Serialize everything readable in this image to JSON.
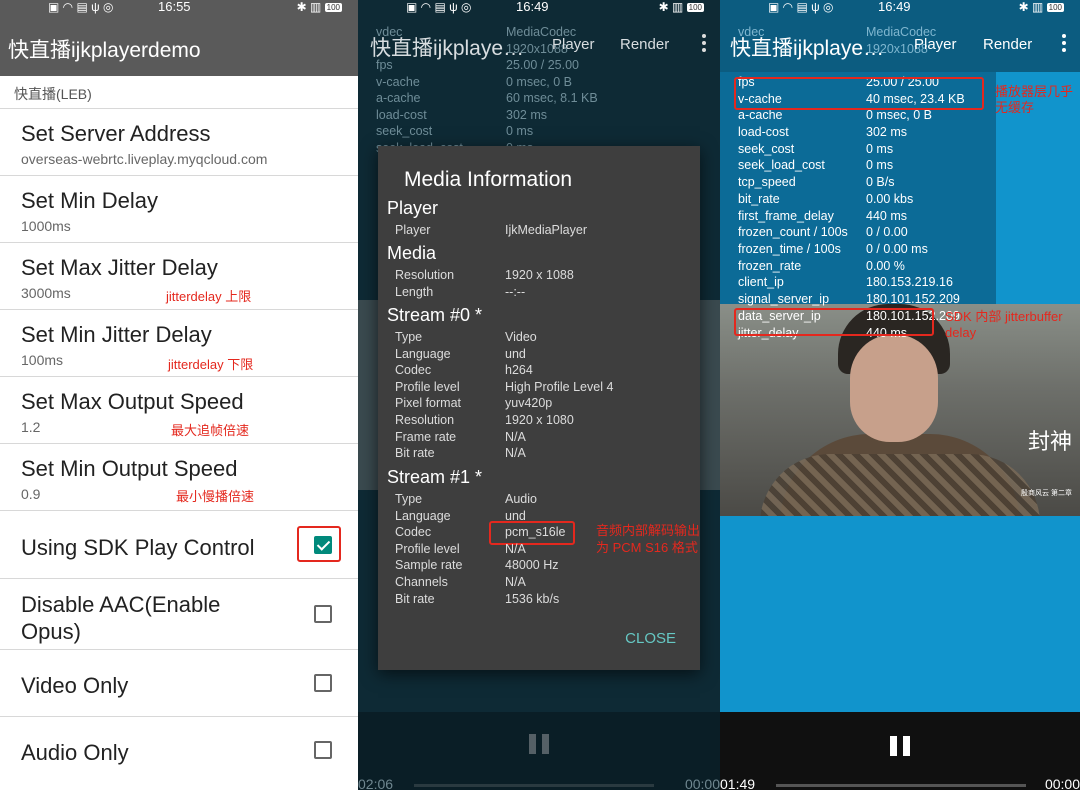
{
  "status_time_1": "16:55",
  "status_time_2": "16:49",
  "status_time_3": "16:49",
  "battery": "100",
  "panel1": {
    "app_title": "快直播ijkplayerdemo",
    "section_header": "快直播(LEB)",
    "items": [
      {
        "title": "Set Server Address",
        "subtitle": "overseas-webrtc.liveplay.myqcloud.com"
      },
      {
        "title": "Set Min Delay",
        "subtitle": "1000ms"
      },
      {
        "title": "Set Max Jitter Delay",
        "subtitle": "3000ms",
        "note": "jitterdelay 上限"
      },
      {
        "title": "Set Min Jitter Delay",
        "subtitle": "100ms",
        "note": "jitterdelay 下限"
      },
      {
        "title": "Set Max Output Speed",
        "subtitle": "1.2",
        "note": "最大追帧倍速"
      },
      {
        "title": "Set Min Output Speed",
        "subtitle": "0.9",
        "note": "最小慢播倍速"
      }
    ],
    "checkboxes": [
      {
        "label": "Using SDK Play Control",
        "checked": true
      },
      {
        "label": "Disable AAC(Enable Opus)",
        "checked": false
      },
      {
        "label": "Video Only",
        "checked": false
      },
      {
        "label": "Audio Only",
        "checked": false
      }
    ]
  },
  "panel2": {
    "overlay_title": "快直播ijkplaye…",
    "menu_player": "Player",
    "menu_render": "Render",
    "bg_stats": [
      {
        "k": "vdec",
        "v": "MediaCodec"
      },
      {
        "k": "",
        "v": "1920x1088"
      },
      {
        "k": "fps",
        "v": "25.00 / 25.00"
      },
      {
        "k": "v-cache",
        "v": "0 msec, 0 B"
      },
      {
        "k": "a-cache",
        "v": "60 msec, 8.1 KB"
      },
      {
        "k": "load-cost",
        "v": "302 ms"
      },
      {
        "k": "seek_cost",
        "v": "0 ms"
      },
      {
        "k": "seek_load_cost",
        "v": "0 ms"
      }
    ],
    "dialog": {
      "title": "Media Information",
      "sections": [
        {
          "name": "Player",
          "rows": [
            {
              "k": "Player",
              "v": "IjkMediaPlayer"
            }
          ]
        },
        {
          "name": "Media",
          "rows": [
            {
              "k": "Resolution",
              "v": "1920 x 1088"
            },
            {
              "k": "Length",
              "v": "--:--"
            }
          ]
        },
        {
          "name": "Stream #0 *",
          "rows": [
            {
              "k": "Type",
              "v": "Video"
            },
            {
              "k": "Language",
              "v": "und"
            },
            {
              "k": "Codec",
              "v": "h264"
            },
            {
              "k": "Profile level",
              "v": "High Profile Level 4"
            },
            {
              "k": "Pixel format",
              "v": "yuv420p"
            },
            {
              "k": "Resolution",
              "v": "1920 x 1080"
            },
            {
              "k": "Frame rate",
              "v": "N/A"
            },
            {
              "k": "Bit rate",
              "v": "N/A"
            }
          ]
        },
        {
          "name": "Stream #1 *",
          "rows": [
            {
              "k": "Type",
              "v": "Audio"
            },
            {
              "k": "Language",
              "v": "und"
            },
            {
              "k": "Codec",
              "v": "pcm_s16le"
            },
            {
              "k": "Profile level",
              "v": "N/A"
            },
            {
              "k": "Sample rate",
              "v": "48000 Hz"
            },
            {
              "k": "Channels",
              "v": "N/A"
            },
            {
              "k": "Bit rate",
              "v": "1536 kb/s"
            }
          ]
        }
      ],
      "close_label": "CLOSE",
      "codec_note": "音频内部解码输出为 PCM S16 格式"
    },
    "time_left": "02:06",
    "time_right": "00:00"
  },
  "panel3": {
    "overlay_title": "快直播ijkplaye…",
    "menu_player": "Player",
    "menu_render": "Render",
    "top_stats": [
      {
        "k": "vdec",
        "v": "MediaCodec"
      },
      {
        "k": "",
        "v": "1920x1088"
      }
    ],
    "stats": [
      {
        "k": "fps",
        "v": "25.00 / 25.00"
      },
      {
        "k": "v-cache",
        "v": "40 msec, 23.4 KB"
      },
      {
        "k": "a-cache",
        "v": "0 msec, 0 B"
      },
      {
        "k": "load-cost",
        "v": "302 ms"
      },
      {
        "k": "seek_cost",
        "v": "0 ms"
      },
      {
        "k": "seek_load_cost",
        "v": "0 ms"
      },
      {
        "k": "tcp_speed",
        "v": "0 B/s"
      },
      {
        "k": "bit_rate",
        "v": "0.00 kbs"
      },
      {
        "k": "first_frame_delay",
        "v": "440 ms"
      },
      {
        "k": "frozen_count / 100s",
        "v": "0 / 0.00"
      },
      {
        "k": "frozen_time / 100s",
        "v": "0 / 0.00 ms"
      },
      {
        "k": "frozen_rate",
        "v": "0.00 %"
      },
      {
        "k": "client_ip",
        "v": "180.153.219.16"
      },
      {
        "k": "signal_server_ip",
        "v": "180.101.152.209"
      },
      {
        "k": "data_server_ip",
        "v": "180.101.152.209"
      },
      {
        "k": "jitter_delay",
        "v": "440 ms"
      }
    ],
    "cache_note": "播放器层几乎无缓存",
    "jitter_note": "SDK 内部 jitterbuffer delay",
    "video_logo": "封神",
    "video_logo_sub": "殷商风云 第二章",
    "time_left": "01:49",
    "time_right": "00:00"
  }
}
